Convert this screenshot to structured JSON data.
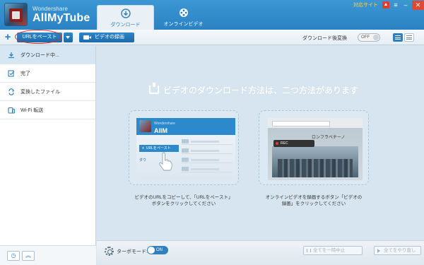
{
  "app": {
    "brand_small": "Wondershare",
    "brand_name": "AllMyTube"
  },
  "tabs": [
    {
      "label": "ダウンロード",
      "icon": "download-icon",
      "active": true
    },
    {
      "label": "オンラインビデオ",
      "icon": "film-reel-icon",
      "active": false
    }
  ],
  "titlebar": {
    "support_link": "対応サイト"
  },
  "toolbar": {
    "paste_url_label": "URLをペースト",
    "record_label": "ビデオの録画",
    "after_download_label": "ダウンロード後変換",
    "after_download_toggle": "OFF"
  },
  "sidebar": {
    "items": [
      {
        "label": "ダウンロード中...",
        "icon": "download-icon",
        "active": true
      },
      {
        "label": "完了",
        "icon": "check-list-icon",
        "active": false
      },
      {
        "label": "変換したファイル",
        "icon": "convert-icon",
        "active": false
      },
      {
        "label": "Wi-Fi 転送",
        "icon": "device-icon",
        "active": false
      }
    ]
  },
  "main": {
    "headline": "ビデオのダウンロード方法は、二つ方法があります",
    "left_caption_line1": "ビデオのURLをコピーして、「URLをペースト」",
    "left_caption_line2": "ボタンをクリックしてください",
    "right_caption_line1": "オンラインビデオを録画するボタン「ビデオの",
    "right_caption_line2": "録画」をクリックしてください",
    "mini_left": {
      "brand_small": "Wondershare",
      "brand_name": "AllM",
      "url_button": "URLをペースト",
      "download_text": "ダウ"
    },
    "mini_right": {
      "site_title": "ロンフラベチーノ",
      "rec_label": "REC"
    }
  },
  "bottom": {
    "turbo_label": "ターボモード:",
    "turbo_toggle": "ON",
    "pause_all": "全てを一時中止",
    "resume_all": "全てをやり直し"
  },
  "colors": {
    "accent": "#2f80bd",
    "header": "#3d97d3",
    "highlight_ring": "#e0291d"
  }
}
